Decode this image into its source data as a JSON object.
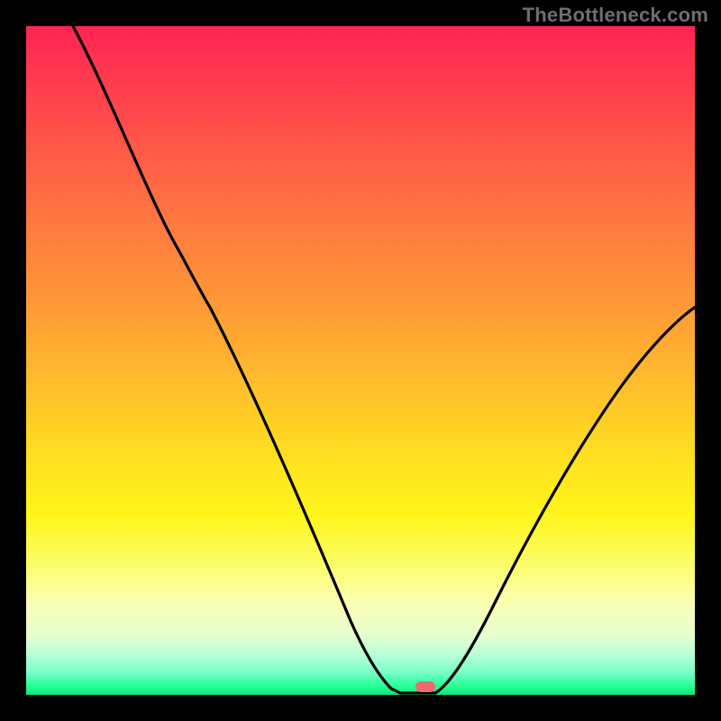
{
  "watermark": "TheBottleneck.com",
  "colors": {
    "frame": "#000000",
    "curve": "#000000",
    "marker": "#ee6a6f",
    "gradient_top": "#ff2353",
    "gradient_mid": "#ffe11f",
    "gradient_bottom": "#14e07d",
    "watermark": "#6e6e6e"
  },
  "chart_data": {
    "type": "line",
    "title": "",
    "xlabel": "",
    "ylabel": "",
    "xlim": [
      0,
      100
    ],
    "ylim": [
      0,
      100
    ],
    "x": [
      7,
      15,
      23,
      27,
      33,
      40,
      46,
      50,
      53,
      56,
      60,
      65,
      70,
      76,
      83,
      90,
      100
    ],
    "values": [
      100,
      85,
      67,
      60,
      48,
      34,
      20,
      10,
      3,
      0,
      0,
      3,
      12,
      23,
      34,
      44,
      58
    ],
    "annotations": [
      {
        "type": "marker-pill",
        "x": 58,
        "y": 0.5
      }
    ],
    "background": "vertical-gradient red→yellow→green"
  }
}
